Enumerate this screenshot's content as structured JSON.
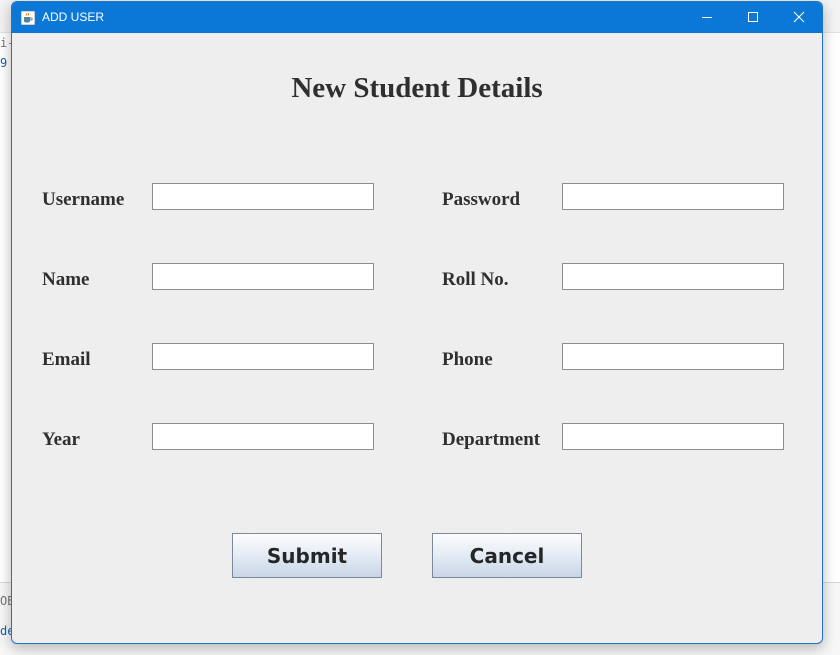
{
  "background": {
    "fragments": [
      "i-",
      "9",
      "OB",
      "de"
    ]
  },
  "window": {
    "title": "ADD USER",
    "icons": {
      "app": "java-coffee-cup-icon",
      "minimize": "minimize-icon",
      "maximize": "maximize-icon",
      "close": "close-icon"
    },
    "accent_color": "#0b78d7"
  },
  "form": {
    "heading": "New Student Details",
    "fields": {
      "username": {
        "label": "Username",
        "value": ""
      },
      "password": {
        "label": "Password",
        "value": ""
      },
      "name": {
        "label": "Name",
        "value": ""
      },
      "roll_no": {
        "label": "Roll No.",
        "value": ""
      },
      "email": {
        "label": "Email",
        "value": ""
      },
      "phone": {
        "label": "Phone",
        "value": ""
      },
      "year": {
        "label": "Year",
        "value": ""
      },
      "department": {
        "label": "Department",
        "value": ""
      }
    },
    "buttons": {
      "submit": "Submit",
      "cancel": "Cancel"
    }
  }
}
